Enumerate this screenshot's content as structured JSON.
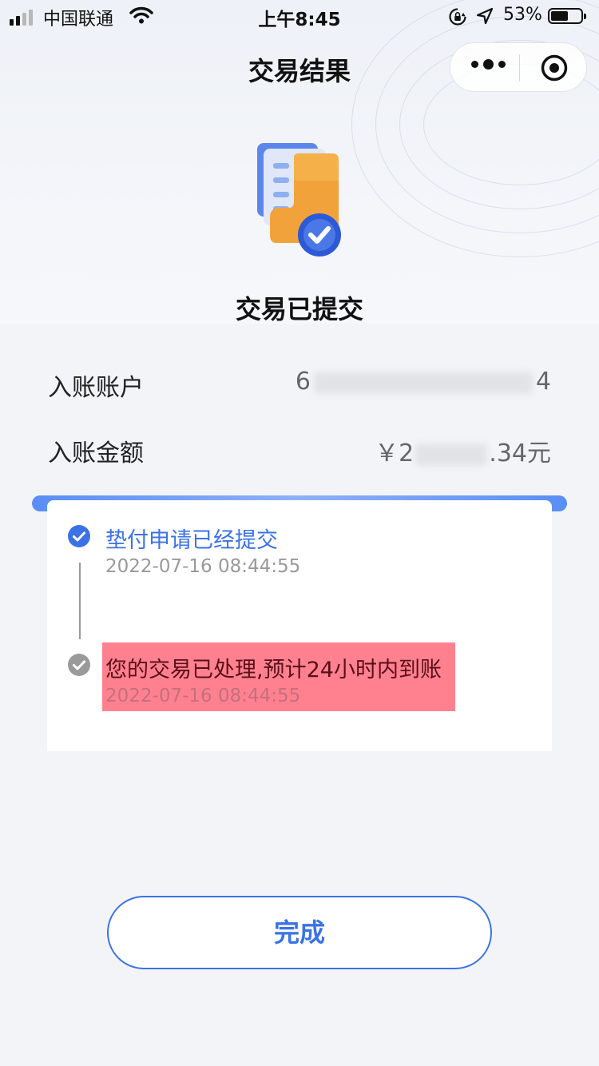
{
  "status_bar": {
    "carrier": "中国联通",
    "time": "上午8:45",
    "battery": "53%",
    "battery_level": 0.53
  },
  "nav": {
    "title": "交易结果",
    "more_icon": "more-dots-icon",
    "close_icon": "target-close-icon"
  },
  "result": {
    "icon": "document-check-icon",
    "title": "交易已提交"
  },
  "details": {
    "account_label": "入账账户",
    "account_prefix": "6",
    "account_suffix": "4",
    "amount_label": "入账金额",
    "amount_prefix": "￥2",
    "amount_suffix": ".34元"
  },
  "timeline": [
    {
      "title": "垫付申请已经提交",
      "time": "2022-07-16 08:44:55",
      "status": "done"
    },
    {
      "title": "您的交易已处理,预计24小时内到账",
      "time": "2022-07-16 08:44:55",
      "status": "pending"
    }
  ],
  "colors": {
    "accent": "#3b72e6",
    "highlight": "#ff5064"
  },
  "actions": {
    "done_label": "完成"
  }
}
